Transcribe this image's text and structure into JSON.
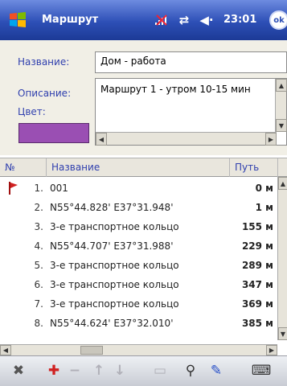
{
  "window": {
    "title": "Маршрут",
    "time": "23:01",
    "ok_label": "ok"
  },
  "status_icons": [
    "signal-off-icon",
    "sync-icon",
    "volume-icon"
  ],
  "form": {
    "name_label": "Название:",
    "name_value": "Дом - работа",
    "description_label": "Описание:",
    "description_value": "Маршрут 1 - утром 10-15 мин",
    "color_label": "Цвет:",
    "color_value": "#9a4fb3"
  },
  "table": {
    "columns": [
      "№",
      "Название",
      "Путь"
    ],
    "rows": [
      {
        "num": "1.",
        "name": "001",
        "dist": "0 м",
        "flag": true
      },
      {
        "num": "2.",
        "name": "N55°44.828' E37°31.948'",
        "dist": "1 м",
        "flag": false
      },
      {
        "num": "3.",
        "name": "3-е транспортное кольцо",
        "dist": "155 м",
        "flag": false
      },
      {
        "num": "4.",
        "name": "N55°44.707' E37°31.988'",
        "dist": "229 м",
        "flag": false
      },
      {
        "num": "5.",
        "name": "3-е транспортное кольцо",
        "dist": "289 м",
        "flag": false
      },
      {
        "num": "6.",
        "name": "3-е транспортное кольцо",
        "dist": "347 м",
        "flag": false
      },
      {
        "num": "7.",
        "name": "3-е транспортное кольцо",
        "dist": "369 м",
        "flag": false
      },
      {
        "num": "8.",
        "name": "N55°44.624' E37°32.010'",
        "dist": "385 м",
        "flag": false
      }
    ]
  },
  "toolbar_icons": [
    "tools-icon",
    "add-point-icon",
    "remove-point-icon",
    "move-up-icon",
    "move-down-icon",
    "edit-icon",
    "search-icon",
    "navigate-icon",
    "keyboard-icon"
  ]
}
